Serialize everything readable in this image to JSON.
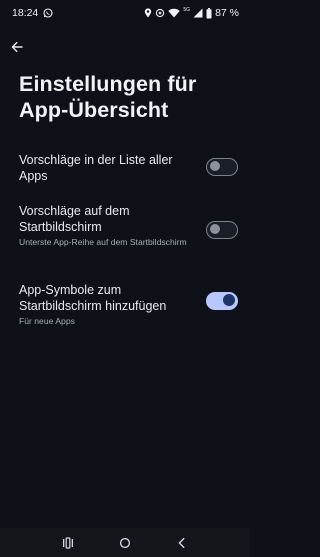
{
  "status_bar": {
    "time": "18:24",
    "network_label": "5G",
    "battery_percent": "87 %",
    "icons": [
      "whatsapp-icon",
      "location-icon",
      "hotspot-icon",
      "wifi-icon",
      "signal-icon",
      "battery-icon"
    ]
  },
  "header": {
    "back_icon": "arrow-left-icon",
    "title": "Einstellungen für App-Übersicht"
  },
  "settings": [
    {
      "title": "Vorschläge in der Liste aller Apps",
      "summary": "",
      "enabled": false
    },
    {
      "title": "Vorschläge auf dem Startbildschirm",
      "summary": "Unterste App-Reihe auf dem Startbildschirm",
      "enabled": false
    },
    {
      "title": "App-Symbole zum Startbildschirm hinzufügen",
      "summary": "Für neue Apps",
      "enabled": true
    }
  ],
  "colors": {
    "background": "#0e1118",
    "toggle_on_track": "#b8c7ff",
    "toggle_on_thumb": "#1f3467",
    "toggle_off_outline": "#7d818b"
  },
  "nav_bar": {
    "icons": [
      "recents-icon",
      "home-icon",
      "back-icon"
    ]
  }
}
